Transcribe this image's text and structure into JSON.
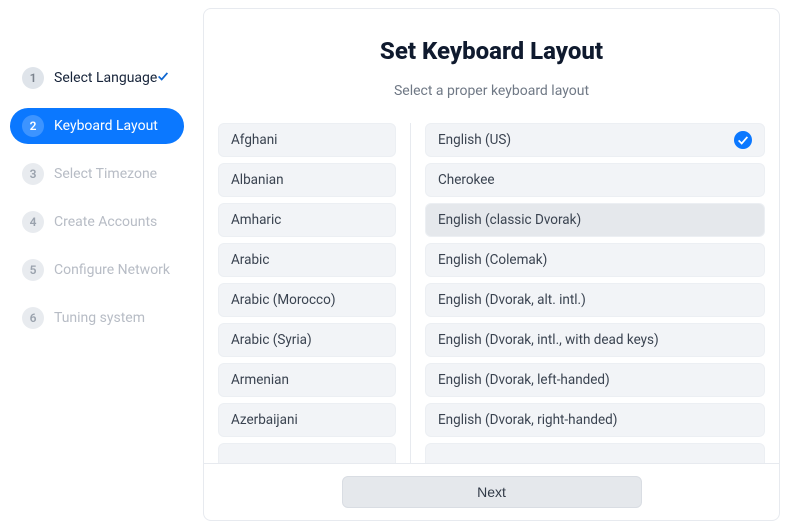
{
  "sidebar": {
    "items": [
      {
        "num": "1",
        "label": "Select Language",
        "state": "completed"
      },
      {
        "num": "2",
        "label": "Keyboard Layout",
        "state": "active"
      },
      {
        "num": "3",
        "label": "Select Timezone",
        "state": "pending"
      },
      {
        "num": "4",
        "label": "Create Accounts",
        "state": "pending"
      },
      {
        "num": "5",
        "label": "Configure Network",
        "state": "pending"
      },
      {
        "num": "6",
        "label": "Tuning system",
        "state": "pending"
      }
    ]
  },
  "panel": {
    "title": "Set Keyboard Layout",
    "subtitle": "Select a proper keyboard layout"
  },
  "keyboard_groups": [
    "Afghani",
    "Albanian",
    "Amharic",
    "Arabic",
    "Arabic (Morocco)",
    "Arabic (Syria)",
    "Armenian",
    "Azerbaijani"
  ],
  "keyboard_groups_peek": " ",
  "keyboard_layouts": [
    {
      "label": "English (US)",
      "selected": true
    },
    {
      "label": "Cherokee",
      "selected": false
    },
    {
      "label": "English (classic Dvorak)",
      "selected": false,
      "hovered": true
    },
    {
      "label": "English (Colemak)",
      "selected": false
    },
    {
      "label": "English (Dvorak, alt. intl.)",
      "selected": false
    },
    {
      "label": "English (Dvorak, intl., with dead keys)",
      "selected": false
    },
    {
      "label": "English (Dvorak, left-handed)",
      "selected": false
    },
    {
      "label": "English (Dvorak, right-handed)",
      "selected": false
    }
  ],
  "keyboard_layouts_peek": " ",
  "footer": {
    "next_label": "Next"
  }
}
